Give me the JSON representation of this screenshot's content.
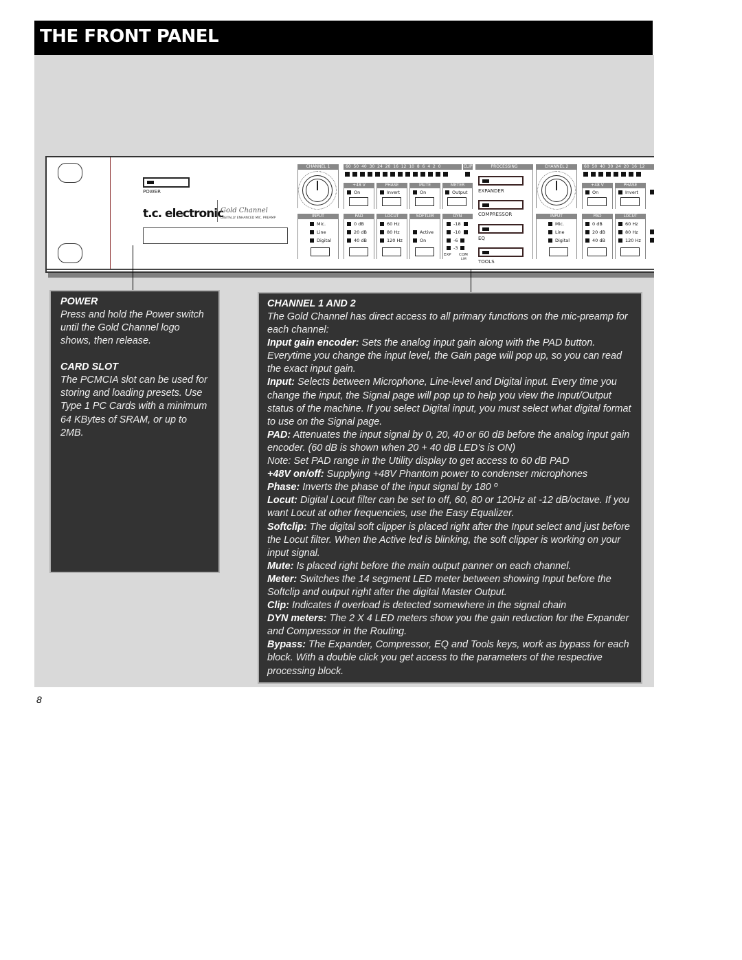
{
  "page": {
    "title": "THE FRONT PANEL",
    "page_number": "8"
  },
  "panel": {
    "power_label": "POWER",
    "logo_brand": "t.c. electronic",
    "logo_product": "Gold Channel",
    "logo_subtitle": "DIGITALLY ENHANCED MIC. PREAMP",
    "channel1": {
      "title": "CHANNEL 1",
      "meter_scale": [
        "60",
        "50",
        "40",
        "30",
        "24",
        "20",
        "16",
        "12",
        "10",
        "8",
        "6",
        "4",
        "2",
        "0"
      ],
      "clip_label": "CLIP",
      "sections": {
        "phantom": {
          "title": "+48 V",
          "options": [
            "On"
          ]
        },
        "phase": {
          "title": "PHASE",
          "options": [
            "Invert"
          ]
        },
        "mute": {
          "title": "MUTE",
          "options": [
            "On"
          ]
        },
        "meter": {
          "title": "METER",
          "options": [
            "Output"
          ]
        },
        "input": {
          "title": "INPUT",
          "options": [
            "Mic.",
            "Line",
            "Digital"
          ]
        },
        "pad": {
          "title": "PAD",
          "options": [
            "0 dB",
            "20 dB",
            "40 dB"
          ]
        },
        "locut": {
          "title": "LOCUT",
          "options": [
            "60 Hz",
            "80 Hz",
            "120 Hz"
          ]
        },
        "softlim": {
          "title": "SOFTLIM",
          "options": [
            "Active",
            "On"
          ]
        },
        "dyn": {
          "title": "DYN",
          "levels": [
            "-18",
            "-10",
            "-6",
            "-3"
          ],
          "exp_label": "EXP",
          "com_label": "COM",
          "lim_label": "LIM"
        }
      }
    },
    "processing": {
      "title": "PROCESSING",
      "buttons": [
        "EXPANDER",
        "COMPRESSOR",
        "EQ",
        "TOOLS"
      ]
    },
    "channel2": {
      "title": "CHANNEL 2",
      "meter_scale": [
        "60",
        "50",
        "40",
        "30",
        "24",
        "20",
        "16",
        "12"
      ],
      "sections": {
        "phantom": {
          "title": "+48 V",
          "options": [
            "On"
          ]
        },
        "phase": {
          "title": "PHASE",
          "options": [
            "Invert"
          ]
        },
        "input": {
          "title": "INPUT",
          "options": [
            "Mic.",
            "Line",
            "Digital"
          ]
        },
        "pad": {
          "title": "PAD",
          "options": [
            "0 dB",
            "20 dB",
            "40 dB"
          ]
        },
        "locut": {
          "title": "LOCUT",
          "options": [
            "60 Hz",
            "80 Hz",
            "120 Hz"
          ]
        }
      }
    }
  },
  "left_box": {
    "power_heading": "POWER",
    "power_text": "Press and hold the Power switch until the Gold Channel logo shows, then release.",
    "card_heading": "CARD SLOT",
    "card_text": "The PCMCIA slot can be used for storing and loading presets. Use Type 1 PC Cards with a minimum 64 KBytes of SRAM, or up to 2MB."
  },
  "right_box": {
    "heading": "CHANNEL 1 AND 2",
    "intro": "The Gold Channel has direct access to all primary functions on the mic-preamp for each channel:",
    "items": [
      {
        "term": "Input gain encoder:",
        "text": " Sets the analog input gain along with the PAD button. Everytime you change the input level, the Gain page will pop up, so you can read the exact input gain."
      },
      {
        "term": "Input:",
        "text": " Selects between Microphone, Line-level and Digital input. Every time you change the input, the Signal page will pop up to help you view the Input/Output status of the machine.  If you select Digital input, you must select what digital format to use on the Signal page."
      },
      {
        "term": "PAD:",
        "text": "  Attenuates the input signal by 0, 20, 40 or 60 dB before the analog input gain encoder. (60 dB is shown when 20 + 40 dB LED’s is ON)"
      },
      {
        "term": "",
        "text": "Note: Set PAD range in the Utility display to get access to 60 dB PAD"
      },
      {
        "term": "+48V on/off:",
        "text": " Supplying +48V Phantom power to condenser microphones"
      },
      {
        "term": "Phase:",
        "text": " Inverts the phase of the input signal by 180 º"
      },
      {
        "term": "Locut:",
        "text": " Digital Locut filter can be set to off, 60, 80 or 120Hz at -12 dB/octave. If you want Locut at other frequencies, use the Easy Equalizer."
      },
      {
        "term": "Softclip:",
        "text": " The digital soft clipper is placed right after the Input select and just before the Locut filter. When the Active led is blinking, the soft clipper is working on your input signal."
      },
      {
        "term": "Mute:",
        "text": " Is placed right before the main output panner on each channel."
      },
      {
        "term": "Meter:",
        "text": " Switches the 14 segment LED meter between showing Input before the Softclip and output right after the digital Master Output."
      },
      {
        "term": "Clip:",
        "text": " Indicates if overload is detected somewhere in the signal chain"
      },
      {
        "term": "DYN meters:",
        "text": " The 2 X 4 LED meters show you the gain reduction for the Expander and Compressor in the Routing."
      },
      {
        "term": "Bypass:",
        "text": " The Expander, Compressor, EQ and Tools keys, work as bypass for each block. With a double click you get access to the parameters of the respective processing block."
      }
    ]
  }
}
